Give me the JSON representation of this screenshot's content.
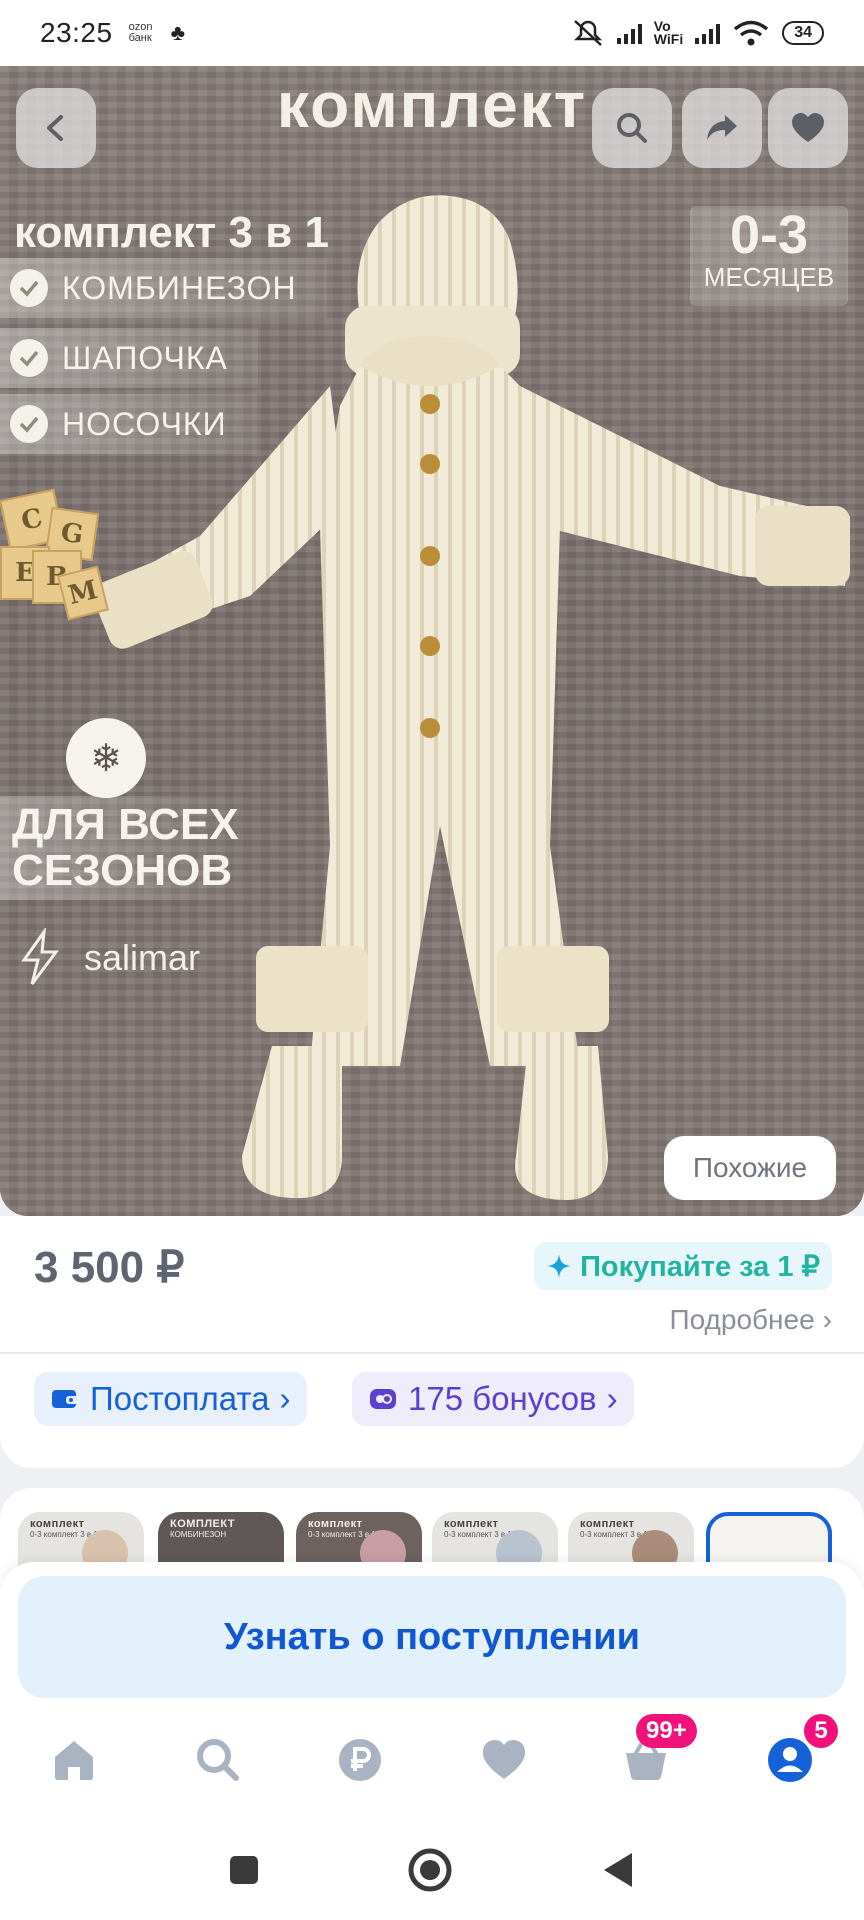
{
  "status_bar": {
    "time": "23:25",
    "ozon_label": "ozon банк",
    "volte_top": "Vo",
    "volte_bottom": "WiFi",
    "battery": "34"
  },
  "product_image": {
    "title": "комплект",
    "set_title": "комплект 3 в 1",
    "features": [
      "КОМБИНЕЗОН",
      "ШАПОЧКА",
      "НОСОЧКИ"
    ],
    "age_value": "0-3",
    "age_unit": "МЕСЯЦЕВ",
    "season_line1": "ДЛЯ ВСЕХ",
    "season_line2": "СЕЗОНОВ",
    "brand": "salimar",
    "similar_label": "Похожие"
  },
  "top_actions": [
    "back-icon",
    "search-icon",
    "share-icon",
    "heart-icon"
  ],
  "price_section": {
    "price": "3 500 ₽",
    "promo": "Покупайте за 1 ₽",
    "more": "Подробнее",
    "postpay": "Постоплата",
    "bonuses": "175 бонусов"
  },
  "thumbnails": [
    {
      "title": "комплект",
      "sub": "0-3 комплект 3 в 1"
    },
    {
      "title": "КОМПЛЕКТ",
      "sub": "КОМБИНЕЗОН"
    },
    {
      "title": "комплект",
      "sub": "0-3 комплект 3 в 1"
    },
    {
      "title": "комплект",
      "sub": "0-3 комплект 3 в 1"
    },
    {
      "title": "комплект",
      "sub": "0-3 комплект 3 в 1"
    },
    {
      "title": "",
      "sub": ""
    }
  ],
  "notify_button": "Узнать о поступлении",
  "tabbar": {
    "cart_badge": "99+",
    "profile_badge": "5",
    "active_color": "#1561d8",
    "inactive_color": "#a9b3c2",
    "badge_color": "#f1117a"
  }
}
